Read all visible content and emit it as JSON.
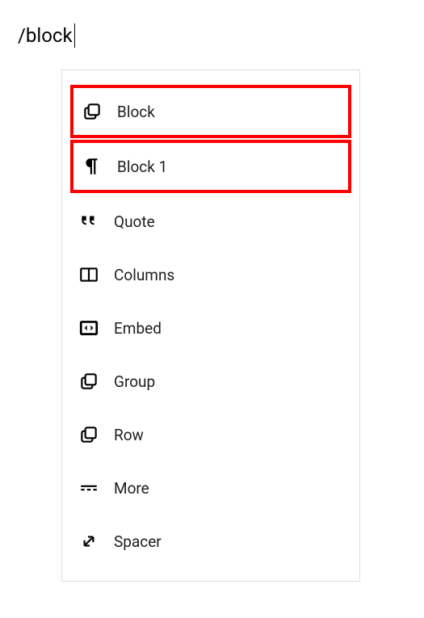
{
  "search": {
    "query": "/block"
  },
  "menu": {
    "items": [
      {
        "label": "Block",
        "icon": "group-icon",
        "highlighted": true
      },
      {
        "label": "Block 1",
        "icon": "paragraph-icon",
        "highlighted": true
      },
      {
        "label": "Quote",
        "icon": "quote-icon",
        "highlighted": false
      },
      {
        "label": "Columns",
        "icon": "columns-icon",
        "highlighted": false
      },
      {
        "label": "Embed",
        "icon": "embed-icon",
        "highlighted": false
      },
      {
        "label": "Group",
        "icon": "group-icon",
        "highlighted": false
      },
      {
        "label": "Row",
        "icon": "group-icon",
        "highlighted": false
      },
      {
        "label": "More",
        "icon": "more-icon",
        "highlighted": false
      },
      {
        "label": "Spacer",
        "icon": "spacer-icon",
        "highlighted": false
      }
    ]
  }
}
